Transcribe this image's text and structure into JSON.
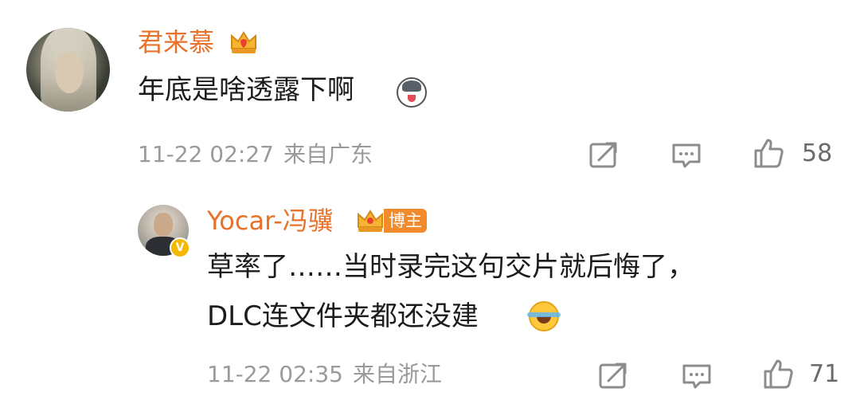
{
  "comment": {
    "username": "君来慕",
    "text": "年底是啥透露下啊",
    "time": "11-22 02:27",
    "location": "来自广东",
    "likes": "58",
    "badge_icon": "crown-icon"
  },
  "reply": {
    "username": "Yocar-冯骥",
    "role_badge": "博主",
    "text_line1": "草率了……当时录完这句交片就后悔了，",
    "text_line2": "DLC连文件夹都还没建",
    "time": "11-22 02:35",
    "location": "来自浙江",
    "likes": "71",
    "verified_icon": "verified-icon"
  },
  "colors": {
    "username": "#e8722a",
    "meta": "#9a9a9a",
    "badge": "#f08a2b"
  }
}
